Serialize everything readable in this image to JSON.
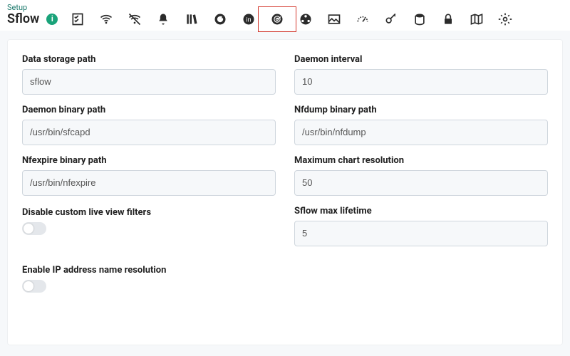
{
  "header": {
    "breadcrumb": "Setup",
    "title": "Sflow",
    "info_glyph": "i"
  },
  "toolbar": {
    "icons": [
      "checklist-icon",
      "wifi-icon",
      "crossed-wifi-icon",
      "bell-icon",
      "library-icon",
      "refresh-icon",
      "info-circle-icon",
      "radar-icon",
      "cluster-icon",
      "image-icon",
      "gauge-icon",
      "key-icon",
      "storage-icon",
      "lock-icon",
      "map-icon",
      "gear-icon"
    ],
    "selected_index": 7
  },
  "form": {
    "data_storage_path": {
      "label": "Data storage path",
      "value": "sflow"
    },
    "daemon_interval": {
      "label": "Daemon interval",
      "value": "10"
    },
    "daemon_binary_path": {
      "label": "Daemon binary path",
      "value": "/usr/bin/sfcapd"
    },
    "nfdump_binary_path": {
      "label": "Nfdump binary path",
      "value": "/usr/bin/nfdump"
    },
    "nfexpire_binary_path": {
      "label": "Nfexpire binary path",
      "value": "/usr/bin/nfexpire"
    },
    "max_chart_resolution": {
      "label": "Maximum chart resolution",
      "value": "50"
    },
    "disable_custom_filters": {
      "label": "Disable custom live view filters",
      "value": false
    },
    "sflow_max_lifetime": {
      "label": "Sflow max lifetime",
      "value": "5"
    },
    "enable_ip_resolution": {
      "label": "Enable IP address name resolution",
      "value": false
    }
  }
}
